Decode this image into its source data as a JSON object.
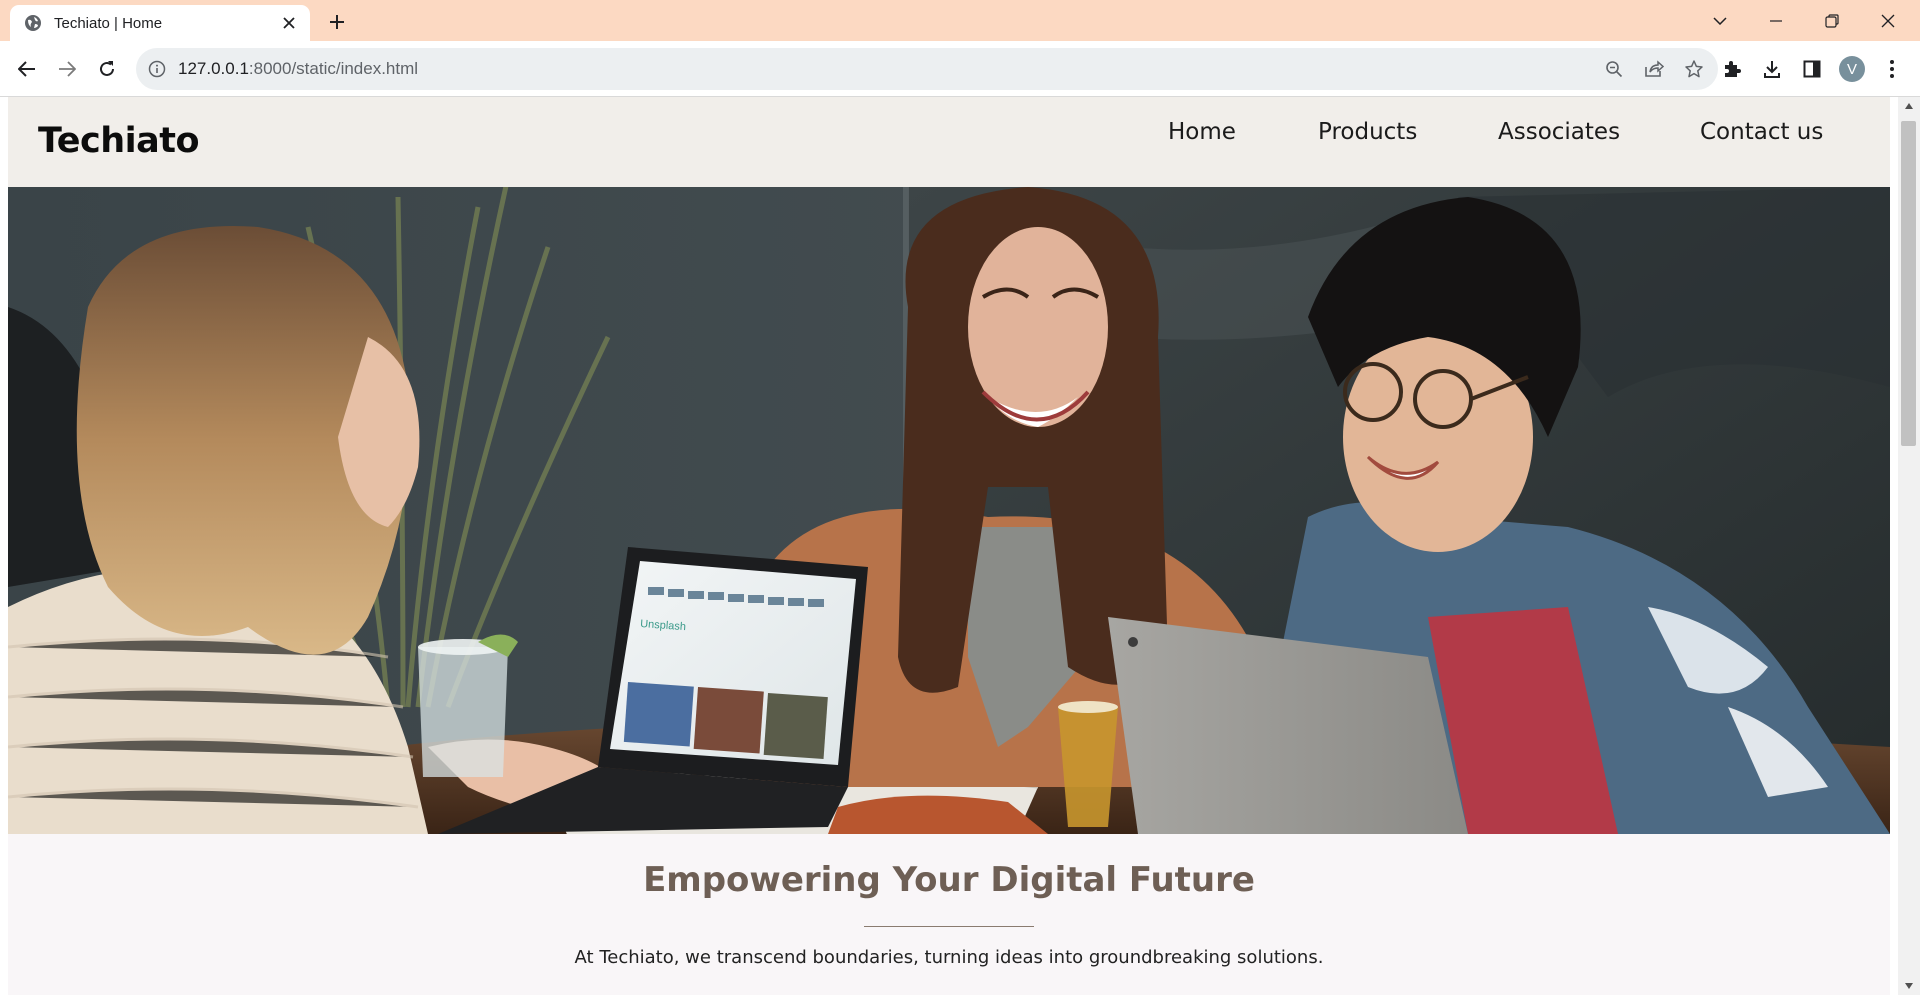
{
  "browser": {
    "tab_title": "Techiato | Home",
    "url_host": "127.0.0.1",
    "url_rest": ":8000/static/index.html",
    "profile_initial": "V",
    "titlebar_color": "#fcd9c2"
  },
  "site": {
    "logo": "Techiato",
    "nav": [
      "Home",
      "Products",
      "Associates",
      "Contact us"
    ],
    "header_bg": "#f1eeea"
  },
  "hero": {
    "image": "Three people laughing around a table with laptops",
    "laptop_screen_text": "Unsplash"
  },
  "intro": {
    "title": "Empowering Your Digital Future",
    "text": "At Techiato, we transcend boundaries, turning ideas into groundbreaking solutions.",
    "title_color": "#6e5f55"
  },
  "icons": [
    "globe-icon",
    "close-icon",
    "plus-icon",
    "chevron-down-icon",
    "minimize-icon",
    "restore-icon",
    "window-close-icon",
    "back-arrow-icon",
    "forward-arrow-icon",
    "reload-icon",
    "info-icon",
    "zoom-out-icon",
    "share-icon",
    "star-icon",
    "puzzle-icon",
    "download-icon",
    "sidebar-icon",
    "more-vert-icon"
  ]
}
